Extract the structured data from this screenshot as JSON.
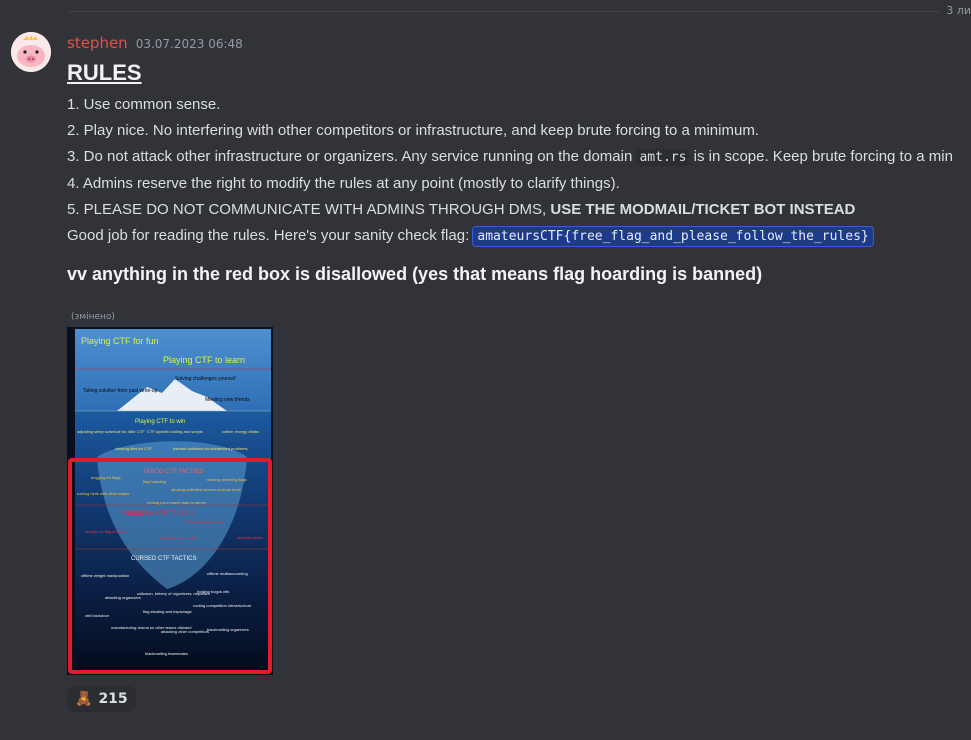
{
  "divider": {
    "label": "3 ли"
  },
  "message": {
    "username": "stephen",
    "timestamp": "03.07.2023 06:48",
    "title": "RULES",
    "rules": [
      {
        "text": "1. Use common sense."
      },
      {
        "text": "2. Play nice. No interfering with other competitors or infrastructure, and keep brute forcing to a minimum."
      },
      {
        "pre": "3. Do not attack other infrastructure or organizers. Any service running on the domain ",
        "code": "amt.rs",
        "post": " is in scope. Keep brute forcing to a min"
      },
      {
        "text": "4. Admins reserve the right to modify the rules at any point (mostly to clarify things)."
      },
      {
        "pre": "5. PLEASE DO NOT COMMUNICATE WITH ADMINS THROUGH DMS, ",
        "bold": "USE THE MODMAIL/TICKET BOT INSTEAD"
      },
      {
        "pre": "Good job for reading the rules. Here's your sanity check flag: ",
        "flag": "amateursCTF{free_flag_and_please_follow_the_rules}"
      }
    ],
    "subheading": "vv anything in the red box is disallowed (yes that means flag hoarding is banned)",
    "edited_label": "(змінено)"
  },
  "iceberg": {
    "tiers": [
      "Playing CTF for fun",
      "Playing CTF to learn",
      "Solving challenges yourself",
      "Taking solution from past write-up",
      "Meeting new friends",
      "Playing CTF to win",
      "adjusting sleep schedule for 48hr CTF",
      "CTF-specific tooling and scripts",
      "coffee; energy drinks",
      "clearing tiles for CTF",
      "banned solutions for unintended problems",
      "TABOO CTF TACTICS",
      "begging for flags",
      "flag hoarding",
      "sharing cheesing flags",
      "trading hints with other teams",
      "abusing unlimited servers to brute force",
      "renting ips in same data to server",
      "FORBIDDEN CTF TACTICS",
      "straight up flag sharing",
      "infiltrating other teams",
      "dropping in flags early",
      "adderall abuse",
      "CURSED CTF TACTICS",
      "ctftime weight manipulation",
      "ctftime multiaccounting",
      "attacking organizers",
      "collusion, bribery of organizers; nepotism",
      "hosting bogus ctfs",
      "ctfd backdoor",
      "flag stealing and espionage",
      "rooting competition infrastructure",
      "manufacturing drama so other teams disband",
      "attacking other competitors",
      "blackmailing organizers",
      "blackmailing teammates"
    ]
  },
  "reaction": {
    "emoji": "🧸",
    "count": "215"
  },
  "colors": {
    "username": "#e0524a",
    "flag_bg": "#1e3a8a",
    "red_box": "#e11d2a",
    "background": "#313338"
  }
}
